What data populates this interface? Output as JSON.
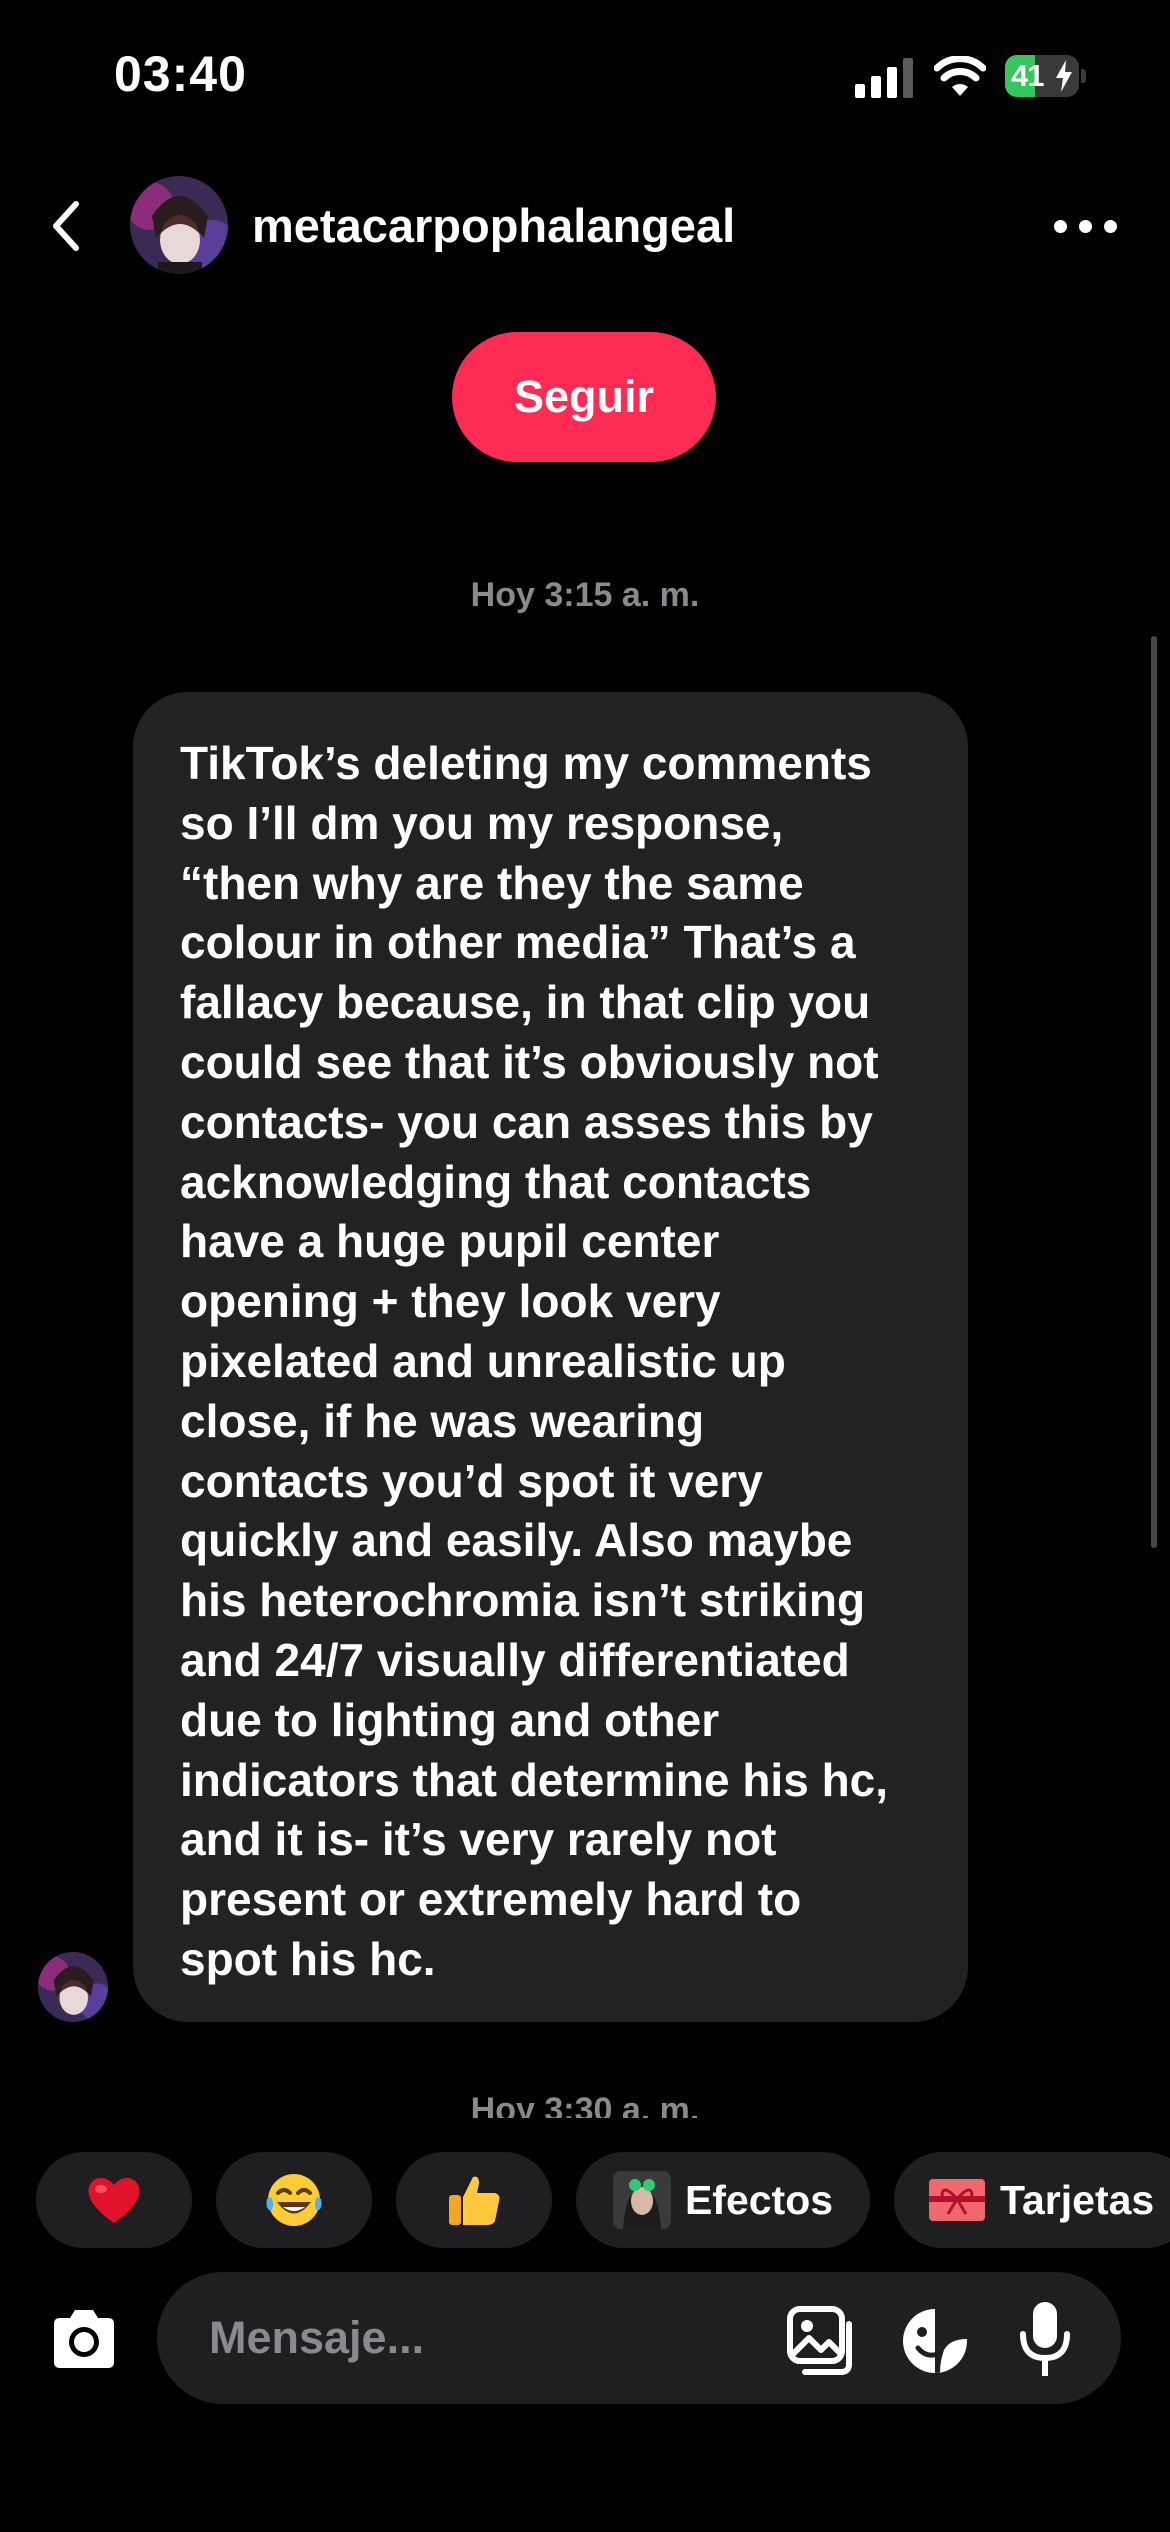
{
  "status_bar": {
    "time": "03:40",
    "battery_percent": "41",
    "battery_level": 0.41,
    "battery_color": "#34c759",
    "icons": [
      "signal-icon",
      "wifi-icon",
      "battery-icon",
      "charging-bolt-icon"
    ]
  },
  "header": {
    "username": "metacarpophalangeal",
    "back_icon": "chevron-left-icon",
    "more_icon": "more-horizontal-icon"
  },
  "follow_button": {
    "label": "Seguir",
    "color": "#fe2c55"
  },
  "conversation": {
    "timestamp_1": "Hoy 3:15 a. m.",
    "message_1": "TikTok’s deleting my comments\nso I’ll dm you my response,\n“then why are they the same\ncolour in other media” That’s a\nfallacy because, in that clip you\ncould see that it’s obviously not\ncontacts- you can asses this by\nacknowledging that contacts\nhave a huge pupil center\nopening + they look very\npixelated and unrealistic up\nclose, if he was wearing\ncontacts you’d spot it very\nquickly and easily. Also maybe\nhis heterochromia isn’t striking\nand 24/7 visually differentiated\ndue to lighting and other\nindicators that determine his hc,\nand it is- it’s very rarely not\npresent or extremely hard to\nspot his hc.",
    "timestamp_2": "Hoy 3:30 a. m."
  },
  "quick_reactions": [
    {
      "icon": "heart-emoji-icon"
    },
    {
      "icon": "laughing-tears-emoji-icon"
    },
    {
      "icon": "thumbs-up-emoji-icon"
    },
    {
      "icon": "effects-thumbnail-icon",
      "label": "Efectos"
    },
    {
      "icon": "gift-card-icon",
      "label": "Tarjetas"
    }
  ],
  "composer": {
    "placeholder": "Mensaje...",
    "icons": [
      "camera-icon",
      "gallery-icon",
      "sticker-icon",
      "microphone-icon"
    ]
  }
}
